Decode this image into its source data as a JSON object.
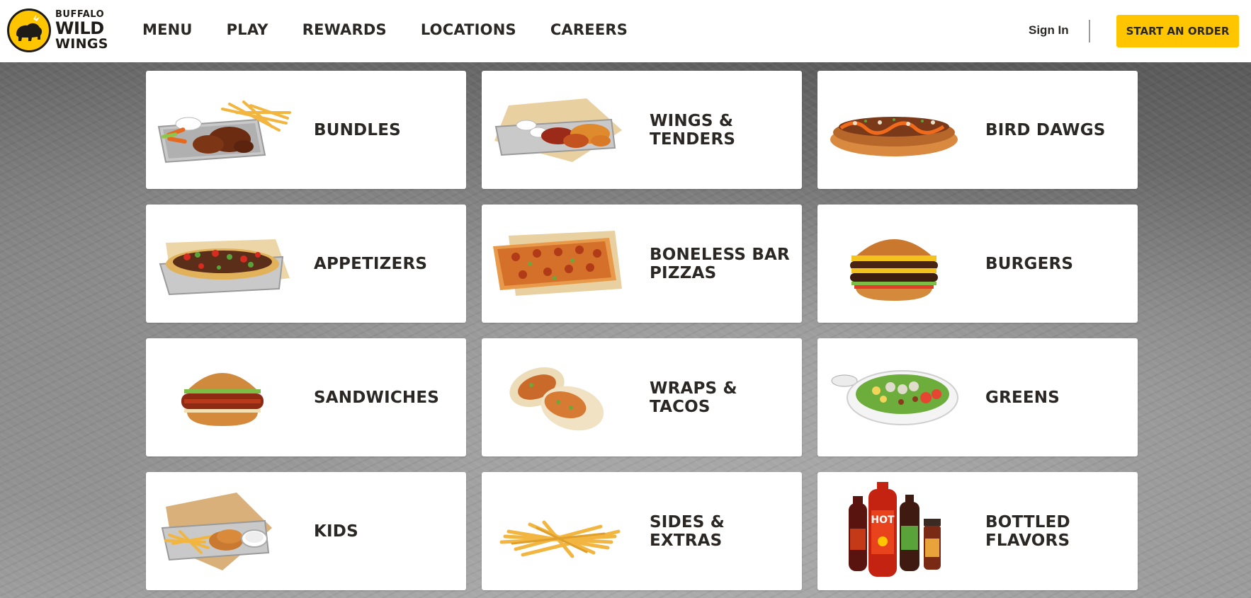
{
  "brand": {
    "line1": "BUFFALO",
    "line2": "WILD",
    "line3": "WINGS",
    "accent": "#ffc600",
    "dark": "#2b2724"
  },
  "nav": {
    "items": [
      {
        "label": "MENU"
      },
      {
        "label": "PLAY"
      },
      {
        "label": "REWARDS"
      },
      {
        "label": "LOCATIONS"
      },
      {
        "label": "CAREERS"
      }
    ],
    "sign_in": "Sign In",
    "order_button": "START AN ORDER"
  },
  "menu": {
    "categories": [
      {
        "label": "BUNDLES",
        "icon": "bundle-tray-icon"
      },
      {
        "label": "WINGS & TENDERS",
        "icon": "wings-tray-icon"
      },
      {
        "label": "BIRD DAWGS",
        "icon": "bird-dawg-icon"
      },
      {
        "label": "APPETIZERS",
        "icon": "nachos-icon"
      },
      {
        "label": "BONELESS BAR PIZZAS",
        "icon": "flatbread-pizza-icon"
      },
      {
        "label": "BURGERS",
        "icon": "burger-icon"
      },
      {
        "label": "SANDWICHES",
        "icon": "chicken-sandwich-icon"
      },
      {
        "label": "WRAPS & TACOS",
        "icon": "wrap-icon"
      },
      {
        "label": "GREENS",
        "icon": "salad-bowl-icon"
      },
      {
        "label": "KIDS",
        "icon": "kids-basket-icon"
      },
      {
        "label": "SIDES & EXTRAS",
        "icon": "fries-icon"
      },
      {
        "label": "BOTTLED FLAVORS",
        "icon": "sauce-bottles-icon"
      }
    ]
  }
}
